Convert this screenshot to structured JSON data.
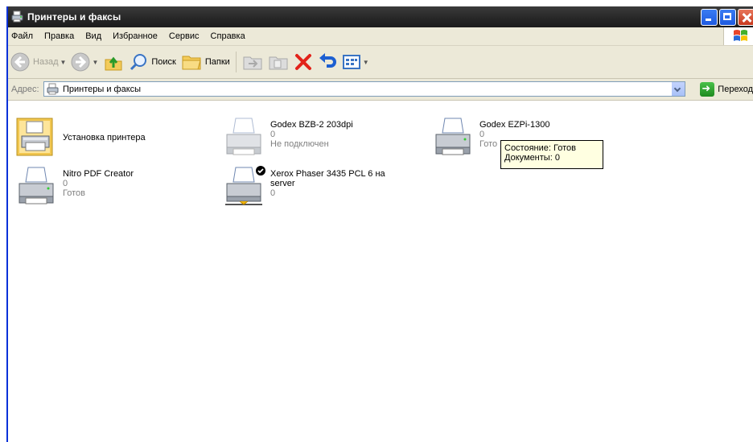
{
  "window": {
    "title": "Принтеры и факсы"
  },
  "menu": {
    "items": [
      "Файл",
      "Правка",
      "Вид",
      "Избранное",
      "Сервис",
      "Справка"
    ]
  },
  "toolbar": {
    "back_label": "Назад",
    "search_label": "Поиск",
    "folders_label": "Папки"
  },
  "address": {
    "label": "Адрес:",
    "value": "Принтеры и факсы",
    "go_label": "Переход"
  },
  "items": [
    {
      "name": "Установка принтера",
      "line2": "",
      "line3": ""
    },
    {
      "name": "Godex BZB-2 203dpi",
      "line2": "0",
      "line3": "Не подключен"
    },
    {
      "name": "Godex EZPi-1300",
      "line2": "0",
      "line3": "Гото"
    },
    {
      "name": "Nitro PDF Creator",
      "line2": "0",
      "line3": "Готов"
    },
    {
      "name": "Xerox Phaser 3435 PCL 6 на",
      "line2": "server",
      "line3": "0"
    }
  ],
  "tooltip": {
    "line1": "Состояние: Готов",
    "line2": "Документы: 0"
  }
}
